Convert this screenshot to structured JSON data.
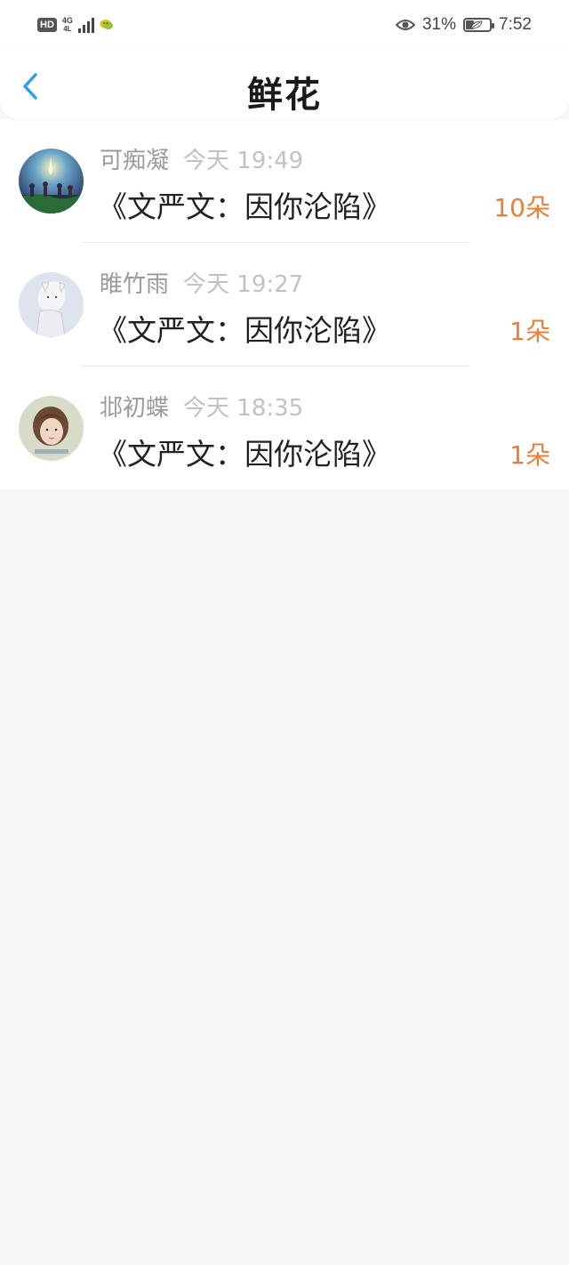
{
  "status_bar": {
    "hd": "HD",
    "network": "4G",
    "network_sub": "4L",
    "battery_percent": "31%",
    "battery_level": 0.31,
    "time": "7:52",
    "icons": [
      "hd-icon",
      "signal-icon",
      "wechat-icon",
      "eye-icon",
      "battery-icon"
    ]
  },
  "header": {
    "title": "鲜花",
    "back_icon": "chevron-left-icon",
    "accent_color": "#2a9ff0"
  },
  "records": [
    {
      "user": "可痴凝",
      "time": "今天 19:49",
      "book": "《文严文：因你沦陷》",
      "count": "10朵"
    },
    {
      "user": "睢竹雨",
      "time": "今天 19:27",
      "book": "《文严文：因你沦陷》",
      "count": "1朵"
    },
    {
      "user": "邶初蝶",
      "time": "今天 18:35",
      "book": "《文严文：因你沦陷》",
      "count": "1朵"
    }
  ],
  "colors": {
    "count": "#ee7e33",
    "name": "#9a9a9a",
    "time": "#c2c2c2",
    "background": "#f8f6f7"
  }
}
